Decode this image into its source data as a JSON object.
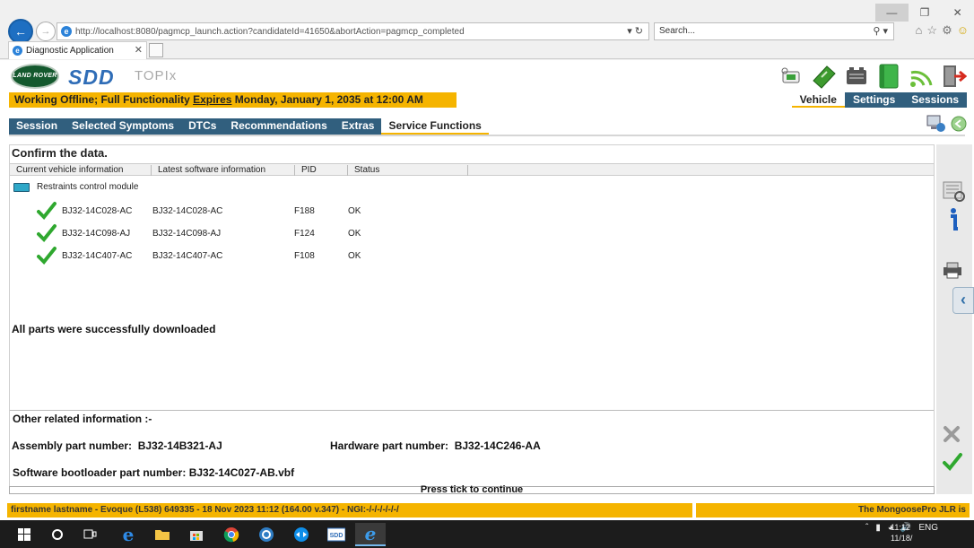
{
  "browser": {
    "url": "http://localhost:8080/pagmcp_launch.action?candidateId=41650&abortAction=pagmcp_completed",
    "search_placeholder": "Search...",
    "tab_title": "Diagnostic Application"
  },
  "app": {
    "brand_lr": "LAND ROVER",
    "brand_sdd": "SDD",
    "brand_topix": "TOPIx",
    "status_prefix": "Working Offline; Full Functionality ",
    "status_expires": "Expires",
    "status_suffix": " Monday, January 1, 2035 at 12:00 AM",
    "top_nav": [
      "Vehicle",
      "Settings",
      "Sessions"
    ],
    "top_nav_active": 0,
    "sub_nav": [
      "Session",
      "Selected Symptoms",
      "DTCs",
      "Recommendations",
      "Extras",
      "Service Functions"
    ],
    "sub_nav_active": 5
  },
  "content": {
    "title": "Confirm the data.",
    "columns": [
      "Current vehicle information",
      "Latest software information",
      "PID",
      "Status"
    ],
    "module_name": "Restraints control module",
    "rows": [
      {
        "current": "BJ32-14C028-AC",
        "latest": "BJ32-14C028-AC",
        "pid": "F188",
        "status": "OK"
      },
      {
        "current": "BJ32-14C098-AJ",
        "latest": "BJ32-14C098-AJ",
        "pid": "F124",
        "status": "OK"
      },
      {
        "current": "BJ32-14C407-AC",
        "latest": "BJ32-14C407-AC",
        "pid": "F108",
        "status": "OK"
      }
    ],
    "success_message": "All parts were successfully downloaded",
    "other_title": "Other related information :-",
    "assembly_label": "Assembly part number:",
    "assembly_value": "BJ32-14B321-AJ",
    "hardware_label": "Hardware part number:",
    "hardware_value": "BJ32-14C246-AA",
    "bootloader_label": "Software bootloader part number:",
    "bootloader_value": "BJ32-14C027-AB.vbf",
    "press_tick": "Press tick to continue"
  },
  "footer": {
    "left": "firstname lastname - Evoque (L538) 649335 - 18 Nov 2023 11:12 (164.00 v.347) - NGI:-/-/-/-/-/-/",
    "right": "The MongoosePro JLR is"
  },
  "taskbar": {
    "language": "ENG",
    "time": "11:12",
    "date": "11/18/"
  },
  "colors": {
    "accent_yellow": "#f5b400",
    "nav_blue": "#315f7e",
    "check_green": "#2fa82f"
  }
}
